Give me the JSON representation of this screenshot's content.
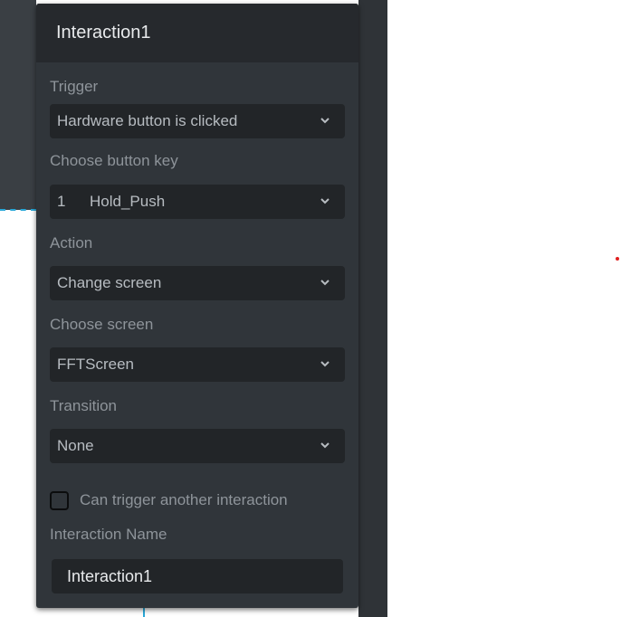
{
  "panel": {
    "title": "Interaction1",
    "trigger": {
      "label": "Trigger",
      "value": "Hardware button is clicked"
    },
    "button_key": {
      "label": "Choose button key",
      "number": "1",
      "value": "Hold_Push"
    },
    "action": {
      "label": "Action",
      "value": "Change screen"
    },
    "screen": {
      "label": "Choose screen",
      "value": "FFTScreen"
    },
    "transition": {
      "label": "Transition",
      "value": "None"
    },
    "can_trigger": {
      "label": "Can trigger another interaction",
      "checked": false
    },
    "interaction_name": {
      "label": "Interaction Name",
      "value": "Interaction1"
    }
  },
  "icons": {
    "dropdown": "chevron-down-icon"
  },
  "colors": {
    "panel_bg": "#30353a",
    "header_bg": "#26292d",
    "field_bg": "#222528",
    "selection_accent": "#2aa8d8",
    "marker": "#e02020"
  }
}
